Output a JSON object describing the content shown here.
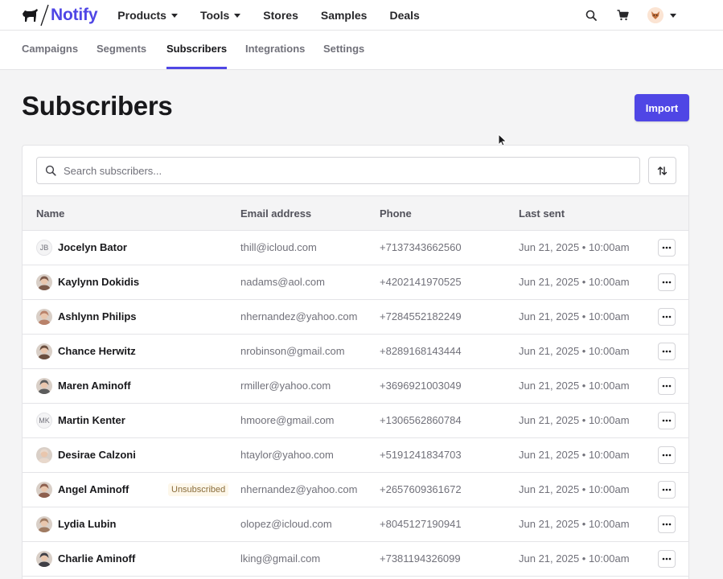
{
  "brand": {
    "name": "Notify",
    "accent": "#4f46e5"
  },
  "topnav": {
    "items": [
      {
        "label": "Products",
        "has_dropdown": true
      },
      {
        "label": "Tools",
        "has_dropdown": true
      },
      {
        "label": "Stores",
        "has_dropdown": false
      },
      {
        "label": "Samples",
        "has_dropdown": false
      },
      {
        "label": "Deals",
        "has_dropdown": false
      }
    ],
    "icons": [
      "search-icon",
      "cart-icon",
      "avatar",
      "chevron-down-icon"
    ]
  },
  "subnav": {
    "tabs": [
      {
        "label": "Campaigns",
        "active": false
      },
      {
        "label": "Segments",
        "active": false
      },
      {
        "label": "Subscribers",
        "active": true
      },
      {
        "label": "Integrations",
        "active": false
      },
      {
        "label": "Settings",
        "active": false
      }
    ]
  },
  "page": {
    "title": "Subscribers",
    "import_label": "Import"
  },
  "search": {
    "placeholder": "Search subscribers..."
  },
  "table": {
    "columns": [
      "Name",
      "Email address",
      "Phone",
      "Last sent"
    ],
    "rows": [
      {
        "name": "Jocelyn Bator",
        "initials": "JB",
        "email": "thill@icloud.com",
        "phone": "+7137343662560",
        "last_sent": "Jun 21, 2025 • 10:00am",
        "badge": ""
      },
      {
        "name": "Kaylynn Dokidis",
        "initials": "",
        "email": "nadams@aol.com",
        "phone": "+4202141970525",
        "last_sent": "Jun 21, 2025 • 10:00am",
        "badge": ""
      },
      {
        "name": "Ashlynn Philips",
        "initials": "",
        "email": "nhernandez@yahoo.com",
        "phone": "+7284552182249",
        "last_sent": "Jun 21, 2025 • 10:00am",
        "badge": ""
      },
      {
        "name": "Chance Herwitz",
        "initials": "",
        "email": "nrobinson@gmail.com",
        "phone": "+8289168143444",
        "last_sent": "Jun 21, 2025 • 10:00am",
        "badge": ""
      },
      {
        "name": "Maren Aminoff",
        "initials": "",
        "email": "rmiller@yahoo.com",
        "phone": "+3696921003049",
        "last_sent": "Jun 21, 2025 • 10:00am",
        "badge": ""
      },
      {
        "name": "Martin Kenter",
        "initials": "MK",
        "email": "hmoore@gmail.com",
        "phone": "+1306562860784",
        "last_sent": "Jun 21, 2025 • 10:00am",
        "badge": ""
      },
      {
        "name": "Desirae Calzoni",
        "initials": "",
        "email": "htaylor@yahoo.com",
        "phone": "+5191241834703",
        "last_sent": "Jun 21, 2025 • 10:00am",
        "badge": ""
      },
      {
        "name": "Angel Aminoff",
        "initials": "",
        "email": "nhernandez@yahoo.com",
        "phone": "+2657609361672",
        "last_sent": "Jun 21, 2025 • 10:00am",
        "badge": "Unsubscribed"
      },
      {
        "name": "Lydia Lubin",
        "initials": "",
        "email": "olopez@icloud.com",
        "phone": "+8045127190941",
        "last_sent": "Jun 21, 2025 • 10:00am",
        "badge": ""
      },
      {
        "name": "Charlie Aminoff",
        "initials": "",
        "email": "lking@gmail.com",
        "phone": "+7381194326099",
        "last_sent": "Jun 21, 2025 • 10:00am",
        "badge": ""
      }
    ]
  },
  "avatar_colors": [
    "#7c5a4a",
    "#b9826a",
    "#6b4f3f",
    "#5c5c5c",
    "#e8d8cc",
    "#8d5f4e",
    "#a07b62",
    "#3f3f46"
  ]
}
